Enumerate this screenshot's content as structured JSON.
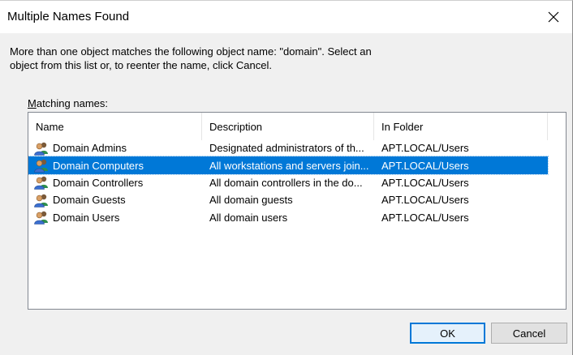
{
  "window": {
    "title": "Multiple Names Found"
  },
  "message": {
    "line1": "More than one object matches the following object name: \"domain\". Select an",
    "line2": "object from this list or, to reenter the name, click Cancel."
  },
  "list": {
    "label_prefix": "M",
    "label_rest": "atching names:",
    "columns": [
      "Name",
      "Description",
      "In Folder"
    ],
    "rows": [
      {
        "name": "Domain Admins",
        "description": "Designated administrators of th...",
        "folder": "APT.LOCAL/Users",
        "selected": false
      },
      {
        "name": "Domain Computers",
        "description": "All workstations and servers join...",
        "folder": "APT.LOCAL/Users",
        "selected": true
      },
      {
        "name": "Domain Controllers",
        "description": "All domain controllers in the do...",
        "folder": "APT.LOCAL/Users",
        "selected": false
      },
      {
        "name": "Domain Guests",
        "description": "All domain guests",
        "folder": "APT.LOCAL/Users",
        "selected": false
      },
      {
        "name": "Domain Users",
        "description": "All domain users",
        "folder": "APT.LOCAL/Users",
        "selected": false
      }
    ],
    "row_icon": "group-icon",
    "selection_color": "#0078d7"
  },
  "buttons": {
    "ok": "OK",
    "cancel": "Cancel"
  },
  "icons": {
    "close": "close-icon",
    "group": "group-icon"
  }
}
